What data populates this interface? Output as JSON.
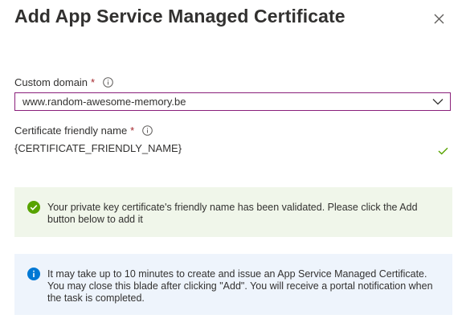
{
  "dialog": {
    "title": "Add App Service Managed Certificate"
  },
  "custom_domain": {
    "label": "Custom domain",
    "required_mark": "*",
    "selected_value": "www.random-awesome-memory.be"
  },
  "friendly_name": {
    "label": "Certificate friendly name",
    "required_mark": "*",
    "value": "{CERTIFICATE_FRIENDLY_NAME}"
  },
  "success_banner": {
    "text": "Your private key certificate's friendly name has been validated. Please click the Add button below to add it"
  },
  "info_banner": {
    "text": "It may take up to 10 minutes to create and issue an App Service Managed Certificate. You may close this blade after clicking \"Add\". You will receive a portal notification when the task is completed."
  },
  "colors": {
    "select_border": "#8a1f7a",
    "success_green": "#57a300",
    "info_blue": "#0078d4",
    "required_red": "#a4262c"
  }
}
